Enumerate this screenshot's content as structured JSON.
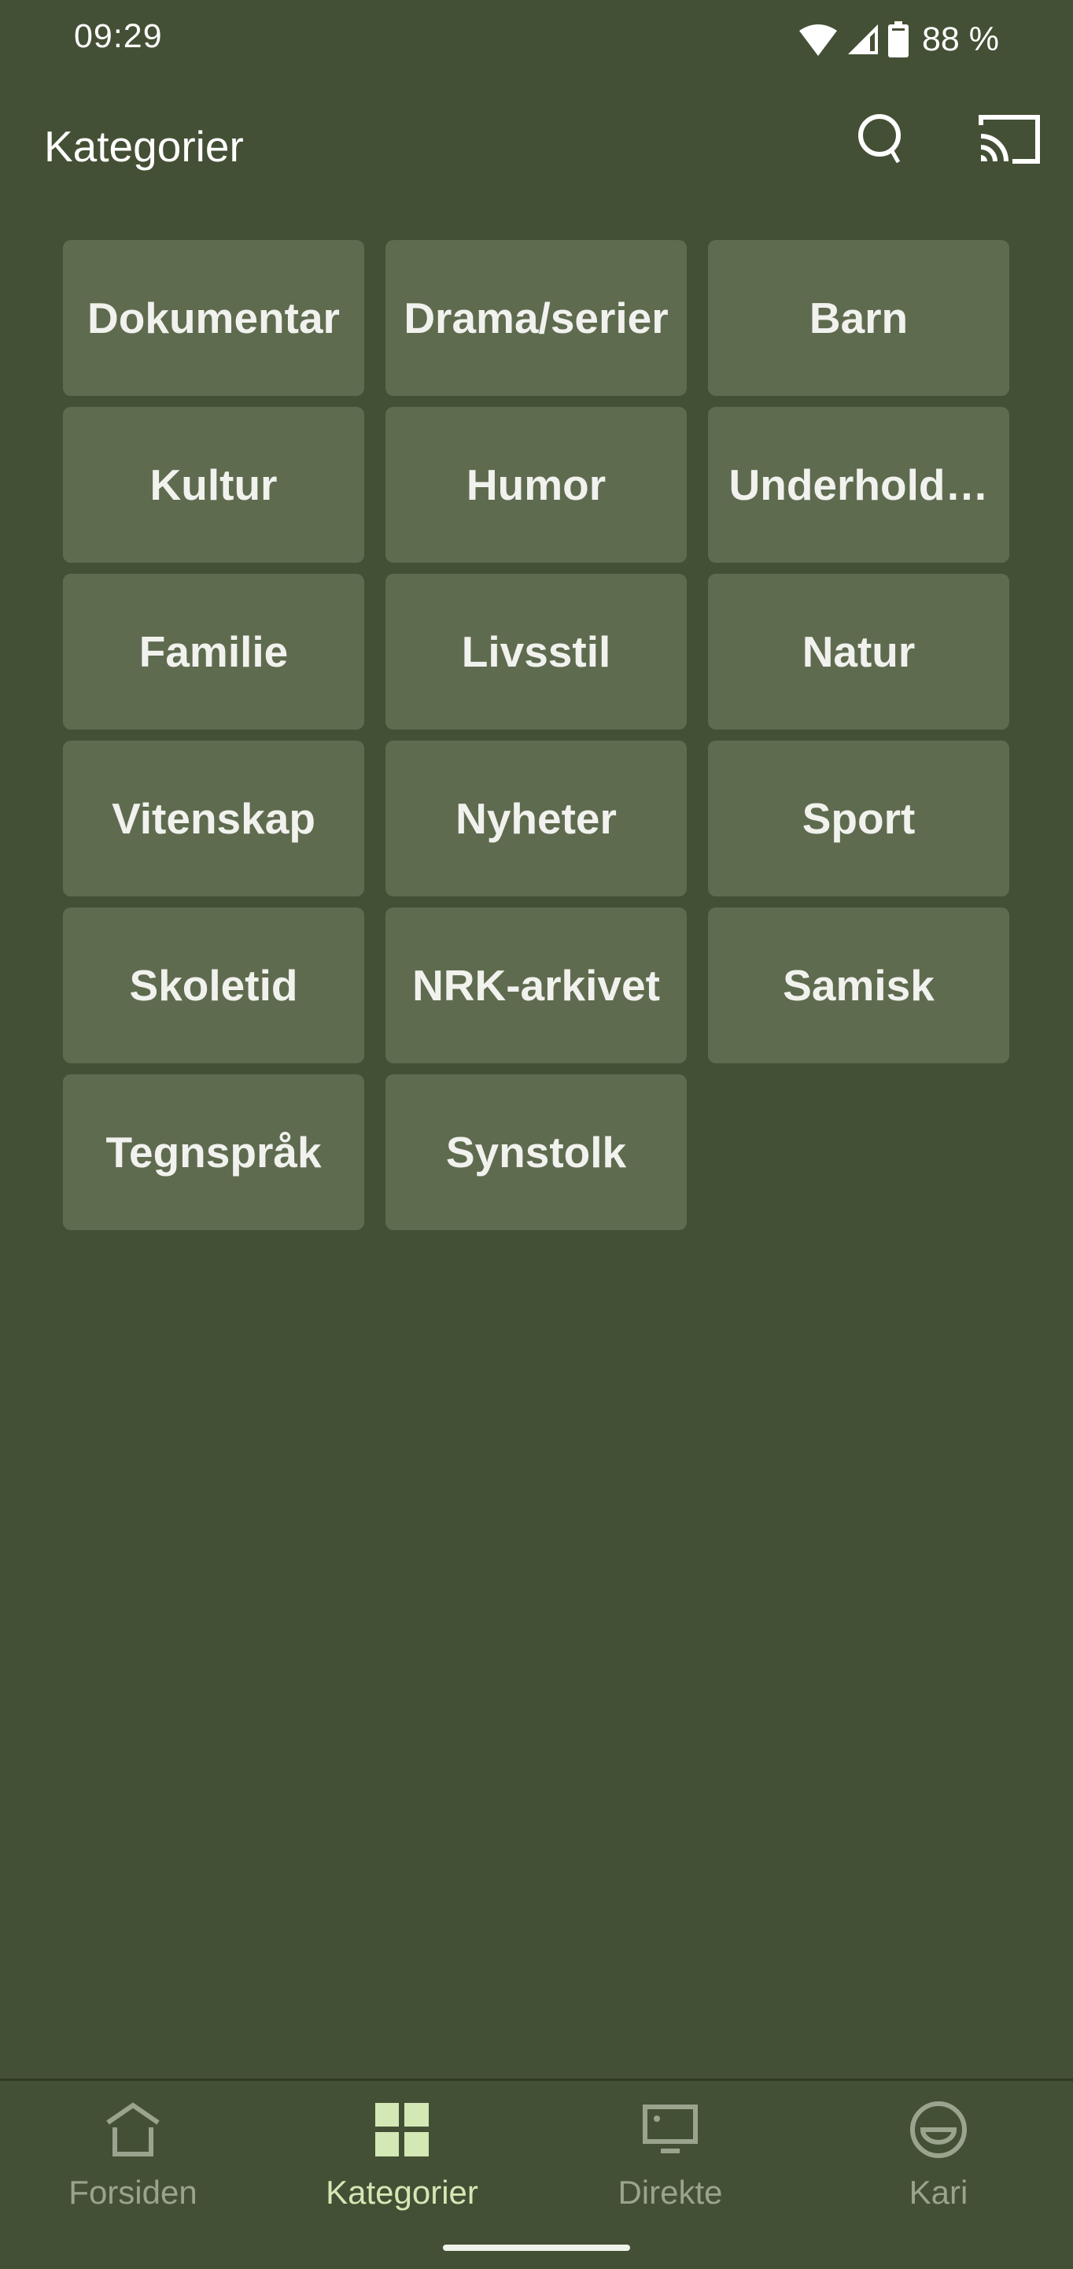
{
  "status_bar": {
    "time": "09:29",
    "battery": "88 %",
    "icons": [
      "wifi-icon",
      "cellular-signal-icon",
      "battery-icon"
    ]
  },
  "app_bar": {
    "title": "Kategorier",
    "actions": [
      "search-icon",
      "cast-icon"
    ]
  },
  "categories": [
    {
      "label": "Dokumentar"
    },
    {
      "label": "Drama/serier"
    },
    {
      "label": "Barn"
    },
    {
      "label": "Kultur"
    },
    {
      "label": "Humor"
    },
    {
      "label": "Underholdning"
    },
    {
      "label": "Familie"
    },
    {
      "label": "Livsstil"
    },
    {
      "label": "Natur"
    },
    {
      "label": "Vitenskap"
    },
    {
      "label": "Nyheter"
    },
    {
      "label": "Sport"
    },
    {
      "label": "Skoletid"
    },
    {
      "label": "NRK-arkivet"
    },
    {
      "label": "Samisk"
    },
    {
      "label": "Tegnspråk"
    },
    {
      "label": "Synstolk"
    }
  ],
  "bottom_nav": {
    "items": [
      {
        "label": "Forsiden",
        "icon": "home-icon",
        "active": false
      },
      {
        "label": "Kategorier",
        "icon": "grid-icon",
        "active": true
      },
      {
        "label": "Direkte",
        "icon": "tv-icon",
        "active": false
      },
      {
        "label": "Kari",
        "icon": "profile-smile-icon",
        "active": false
      }
    ]
  },
  "colors": {
    "background": "#445035",
    "tile": "#5f6b4f",
    "text": "#f1f2ee",
    "nav_active": "#d3e8b4",
    "nav_inactive": "#9aa38e"
  }
}
